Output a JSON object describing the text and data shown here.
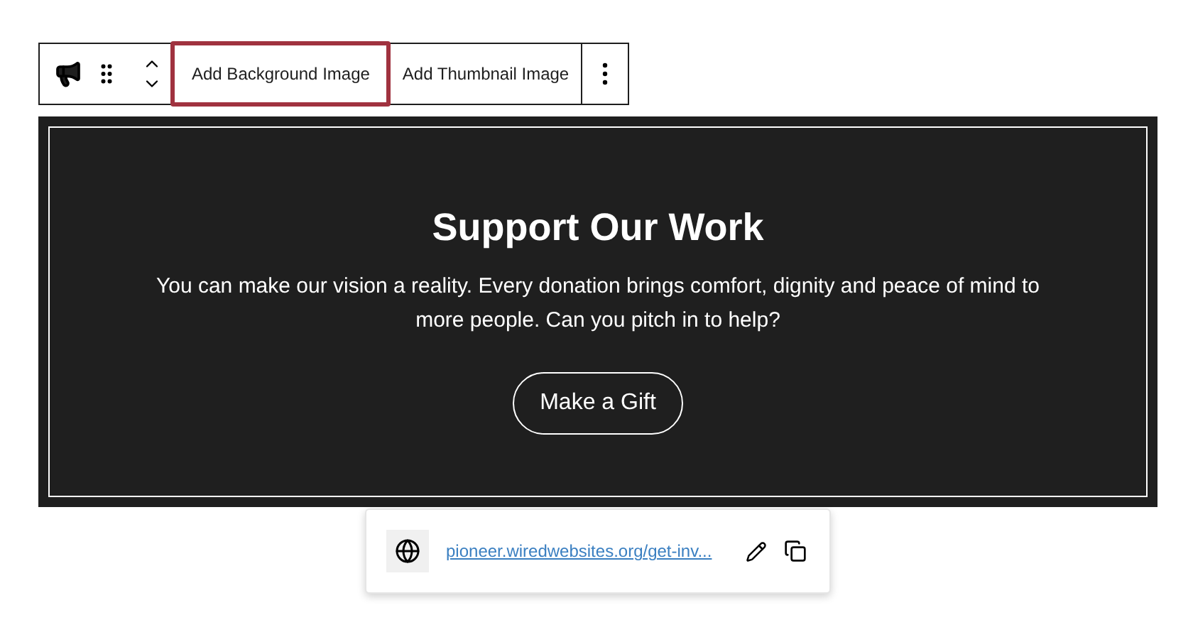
{
  "toolbar": {
    "buttons": [
      {
        "label": "Add Background Image",
        "highlighted": true
      },
      {
        "label": "Add Thumbnail Image",
        "highlighted": false
      }
    ]
  },
  "banner": {
    "title": "Support Our Work",
    "text": "You can make our vision a reality. Every donation brings comfort, dignity and peace of mind to more people. Can you pitch in to help?",
    "button": "Make a Gift"
  },
  "link_popover": {
    "url": "pioneer.wiredwebsites.org/get-inv..."
  }
}
